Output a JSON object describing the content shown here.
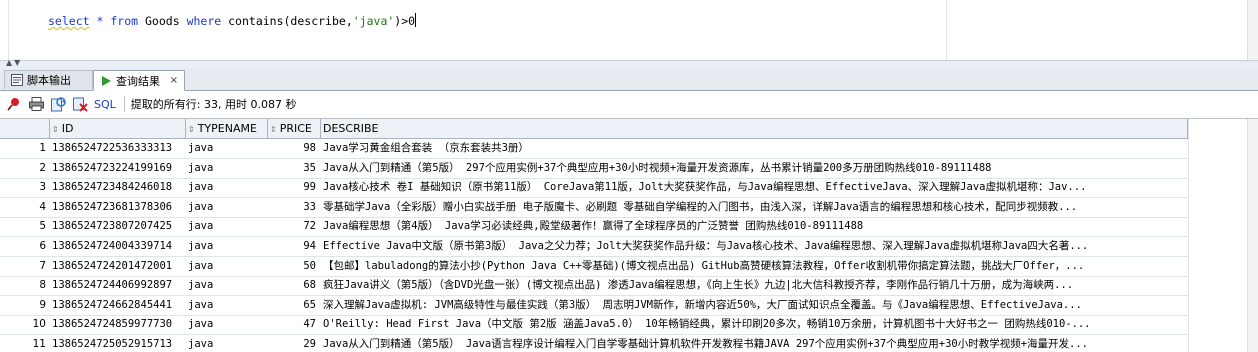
{
  "editor": {
    "sql_select": "select",
    "sql_star": "*",
    "sql_from": "from",
    "sql_table": "Goods",
    "sql_where": "where",
    "sql_func": "contains(describe,",
    "sql_string": "'java'",
    "sql_tail": ")>0"
  },
  "tabs": [
    {
      "label": "脚本输出",
      "icon": "script-output-icon"
    },
    {
      "label": "查询结果",
      "icon": "play-icon",
      "close": "×"
    }
  ],
  "toolbar": {
    "sql_label": "SQL",
    "status": "提取的所有行: 33, 用时 0.087 秒"
  },
  "grid": {
    "columns": [
      "ID",
      "TYPENAME",
      "PRICE",
      "DESCRIBE"
    ],
    "rows": [
      {
        "n": "1",
        "id": "1386524722536333313",
        "type": "java",
        "price": "98",
        "desc": "Java学习黄金组合套装 （京东套装共3册）"
      },
      {
        "n": "2",
        "id": "1386524723224199169",
        "type": "java",
        "price": "35",
        "desc": "Java从入门到精通（第5版） 297个应用实例+37个典型应用+30小时视频+海量开发资源库，丛书累计销量200多万册团购热线010-89111488"
      },
      {
        "n": "3",
        "id": "1386524723484246018",
        "type": "java",
        "price": "99",
        "desc": "Java核心技术 卷I 基础知识（原书第11版） CoreJava第11版，Jolt大奖获奖作品，与Java编程思想、EffectiveJava、深入理解Java虚拟机堪称：Jav..."
      },
      {
        "n": "4",
        "id": "1386524723681378306",
        "type": "java",
        "price": "33",
        "desc": "零基础学Java（全彩版）赠小白实战手册 电子版魔卡、必刷题 零基础自学编程的入门图书，由浅入深，详解Java语言的编程思想和核心技术，配同步视频教..."
      },
      {
        "n": "5",
        "id": "1386524723807207425",
        "type": "java",
        "price": "72",
        "desc": "Java编程思想（第4版） Java学习必读经典,殿堂级著作！赢得了全球程序员的广泛赞誉 团购热线010-89111488"
      },
      {
        "n": "6",
        "id": "1386524724004339714",
        "type": "java",
        "price": "94",
        "desc": "Effective Java中文版（原书第3版） Java之父力荐；Jolt大奖获奖作品升级：与Java核心技术、Java编程思想、深入理解Java虚拟机堪称Java四大名著..."
      },
      {
        "n": "7",
        "id": "1386524724201472001",
        "type": "java",
        "price": "50",
        "desc": "【包邮】labuladong的算法小抄(Python Java C++零基础)(博文视点出品) GitHub高赞硬核算法教程，Offer收割机带你搞定算法题，挑战大厂Offer，..."
      },
      {
        "n": "8",
        "id": "1386524724406992897",
        "type": "java",
        "price": "68",
        "desc": "疯狂Java讲义（第5版）（含DVD光盘一张）(博文视点出品) 渗透Java编程思想，《向上生长》九边|北大信科教授齐荐，李刚作品行销几十万册，成为海峡两..."
      },
      {
        "n": "9",
        "id": "1386524724662845441",
        "type": "java",
        "price": "65",
        "desc": "深入理解Java虚拟机: JVM高级特性与最佳实践（第3版） 周志明JVM新作，新增内容近50%，大厂面试知识点全覆盖。与《Java编程思想、EffectiveJava..."
      },
      {
        "n": "10",
        "id": "1386524724859977730",
        "type": "java",
        "price": "47",
        "desc": "O'Reilly: Head First Java（中文版 第2版 涵盖Java5.0） 10年畅销经典，累计印刷20多次，畅销10万余册，计算机图书十大好书之一 团购热线010-..."
      },
      {
        "n": "11",
        "id": "1386524725052915713",
        "type": "java",
        "price": "29",
        "desc": "Java从入门到精通（第5版） Java语言程序设计编程入门自学零基础计算机软件开发教程书籍JAVA 297个应用实例+37个典型应用+30小时教学视频+海量开发..."
      }
    ]
  }
}
